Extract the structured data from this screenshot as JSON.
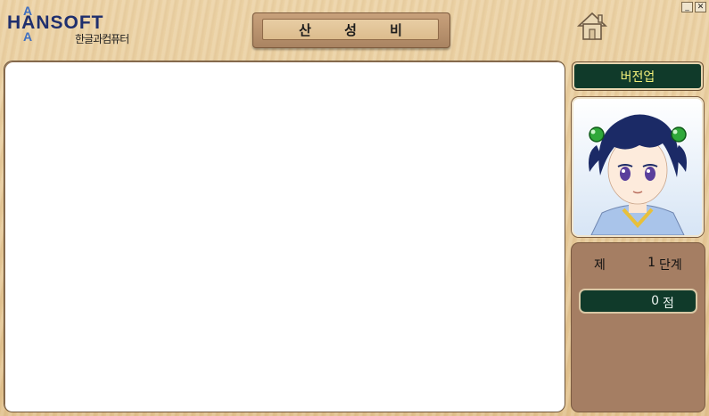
{
  "logo": {
    "brand": "HANSOFT",
    "accent_letter": "A",
    "company": "한글과컴퓨터"
  },
  "title": "산 성 비",
  "window_controls": {
    "minimize": "_",
    "close": "✕"
  },
  "home_icon": "home-icon",
  "version_button": "버전업",
  "status": {
    "level_prefix": "제",
    "level_value": "1",
    "level_suffix": "단계",
    "score_value": "0",
    "score_unit": "점"
  },
  "colors": {
    "dark_green": "#103a2a",
    "version_text": "#f2f07a",
    "wood": "#e2c28e",
    "status_panel": "#a57e63",
    "logo_blue": "#1f2f6e"
  }
}
